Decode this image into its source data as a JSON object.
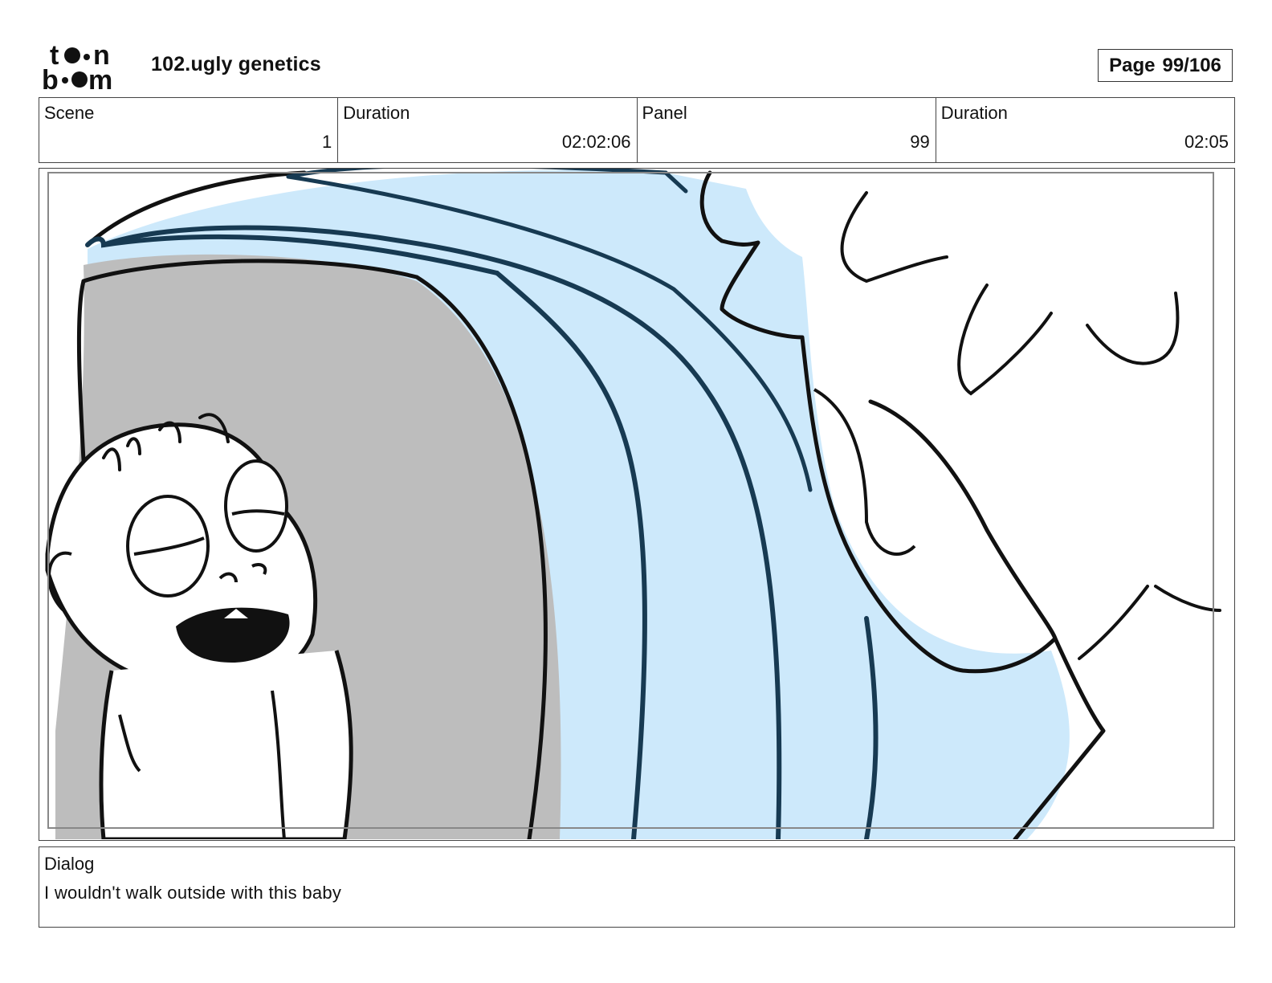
{
  "header": {
    "logo_text": "toon boom",
    "project_title": "102.ugly genetics",
    "page_label": "Page",
    "page_value": "99/106"
  },
  "info": {
    "scene_label": "Scene",
    "scene_value": "1",
    "scene_duration_label": "Duration",
    "scene_duration_value": "02:02:06",
    "panel_label": "Panel",
    "panel_value": "99",
    "panel_duration_label": "Duration",
    "panel_duration_value": "02:05"
  },
  "panel_image": {
    "description_icon": "storyboard-sketch",
    "colors": {
      "tunnel_gray": "#bdbdbd",
      "light_blue": "#cde9fb",
      "dark_blue_stroke": "#173a52",
      "ink": "#111111"
    }
  },
  "dialog": {
    "label": "Dialog",
    "text": "I wouldn't walk outside with this baby"
  }
}
